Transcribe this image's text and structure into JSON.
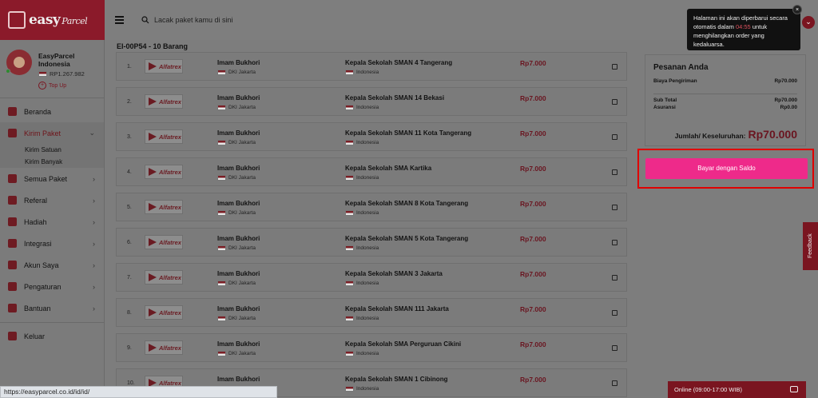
{
  "brand": {
    "name": "easy",
    "script": "Parcel"
  },
  "search": {
    "placeholder": "Lacak paket kamu di sini"
  },
  "profile": {
    "name": "EasyParcel Indonesia",
    "balance": "RP1.267.982",
    "topup": "Top Up"
  },
  "menu": [
    {
      "label": "Beranda"
    },
    {
      "label": "Kirim Paket",
      "sub": [
        "Kirim Satuan",
        "Kirim Banyak"
      ]
    },
    {
      "label": "Semua Paket"
    },
    {
      "label": "Referal"
    },
    {
      "label": "Hadiah"
    },
    {
      "label": "Integrasi"
    },
    {
      "label": "Akun Saya"
    },
    {
      "label": "Pengaturan"
    },
    {
      "label": "Bantuan"
    },
    {
      "label": "Keluar"
    }
  ],
  "batch_title": "EI-00P54 - 10 Barang",
  "parcels": [
    {
      "no": "1.",
      "carrier": "Alfatrex",
      "sender": "Imam Bukhori",
      "sender_loc": "DKI Jakarta",
      "receiver": "Kepala Sekolah SMAN 4 Tangerang",
      "receiver_loc": "Indonesia",
      "price": "Rp7.000"
    },
    {
      "no": "2.",
      "carrier": "Alfatrex",
      "sender": "Imam Bukhori",
      "sender_loc": "DKI Jakarta",
      "receiver": "Kepala Sekolah SMAN 14 Bekasi",
      "receiver_loc": "Indonesia",
      "price": "Rp7.000"
    },
    {
      "no": "3.",
      "carrier": "Alfatrex",
      "sender": "Imam Bukhori",
      "sender_loc": "DKI Jakarta",
      "receiver": "Kepala Sekolah SMAN 11 Kota Tangerang",
      "receiver_loc": "Indonesia",
      "price": "Rp7.000"
    },
    {
      "no": "4.",
      "carrier": "Alfatrex",
      "sender": "Imam Bukhori",
      "sender_loc": "DKI Jakarta",
      "receiver": "Kepala Sekolah SMA Kartika",
      "receiver_loc": "Indonesia",
      "price": "Rp7.000"
    },
    {
      "no": "5.",
      "carrier": "Alfatrex",
      "sender": "Imam Bukhori",
      "sender_loc": "DKI Jakarta",
      "receiver": "Kepala Sekolah SMAN 8 Kota Tangerang",
      "receiver_loc": "Indonesia",
      "price": "Rp7.000"
    },
    {
      "no": "6.",
      "carrier": "Alfatrex",
      "sender": "Imam Bukhori",
      "sender_loc": "DKI Jakarta",
      "receiver": "Kepala Sekolah SMAN 5 Kota Tangerang",
      "receiver_loc": "Indonesia",
      "price": "Rp7.000"
    },
    {
      "no": "7.",
      "carrier": "Alfatrex",
      "sender": "Imam Bukhori",
      "sender_loc": "DKI Jakarta",
      "receiver": "Kepala Sekolah SMAN 3 Jakarta",
      "receiver_loc": "Indonesia",
      "price": "Rp7.000"
    },
    {
      "no": "8.",
      "carrier": "Alfatrex",
      "sender": "Imam Bukhori",
      "sender_loc": "DKI Jakarta",
      "receiver": "Kepala Sekolah SMAN 111 Jakarta",
      "receiver_loc": "Indonesia",
      "price": "Rp7.000"
    },
    {
      "no": "9.",
      "carrier": "Alfatrex",
      "sender": "Imam Bukhori",
      "sender_loc": "DKI Jakarta",
      "receiver": "Kepala Sekolah SMA Perguruan Cikini",
      "receiver_loc": "Indonesia",
      "price": "Rp7.000"
    },
    {
      "no": "10.",
      "carrier": "Alfatrex",
      "sender": "Imam Bukhori",
      "sender_loc": "DKI Jakarta",
      "receiver": "Kepala Sekolah SMAN 1 Cibinong",
      "receiver_loc": "Indonesia",
      "price": "Rp7.000"
    }
  ],
  "order": {
    "title": "Pesanan Anda",
    "shipping_label": "Biaya Pengiriman",
    "shipping_value": "Rp70.000",
    "subtotal_label": "Sub Total",
    "subtotal_value": "Rp70.000",
    "insurance_label": "Asuransi",
    "insurance_value": "Rp0.00",
    "total_label": "Jumlah/ Keseluruhan:",
    "total_value": "Rp70.000",
    "pay_button": "Bayar dengan Saldo"
  },
  "tooltip": {
    "before": "Halaman ini akan diperbarui secara otomatis dalam ",
    "countdown": "04:55",
    "after": " untuk menghilangkan order yang kedaluarsa.",
    "close": "×"
  },
  "feedback": "Feedback",
  "online": "Online (09:00-17:00 WIB)",
  "status_url": "https://easyparcel.co.id/id/id/",
  "colors": {
    "brand": "#8b1a2a",
    "accent": "#ee2a8a",
    "highlight_border": "#e00000"
  }
}
